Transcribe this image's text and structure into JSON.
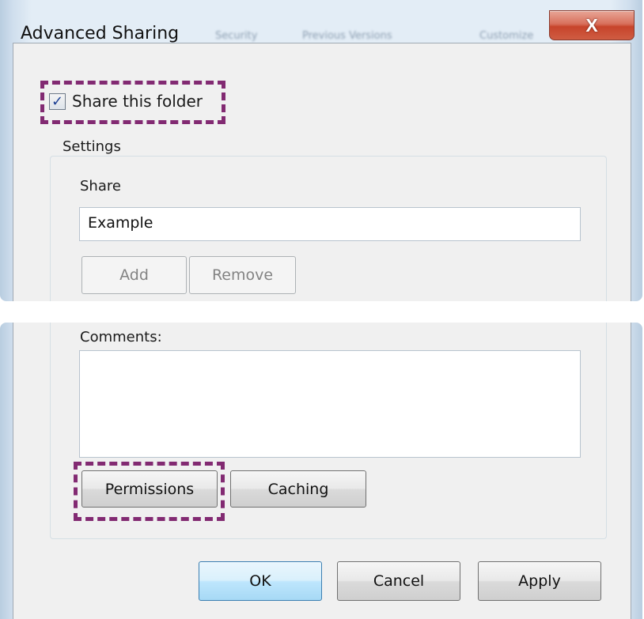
{
  "window": {
    "title": "Advanced Sharing",
    "background_tabs": [
      "Security",
      "Previous Versions",
      "Customize"
    ],
    "close_label": "X"
  },
  "share_checkbox": {
    "label": "Share this folder",
    "checked": true,
    "check_mark": "✓"
  },
  "settings": {
    "legend": "Settings",
    "share_label": "Share",
    "share_value": "Example",
    "add_label": "Add",
    "remove_label": "Remove",
    "comments_label": "Comments:",
    "comments_value": "",
    "permissions_label": "Permissions",
    "caching_label": "Caching"
  },
  "footer": {
    "ok_label": "OK",
    "cancel_label": "Cancel",
    "apply_label": "Apply"
  },
  "colors": {
    "highlight": "#822a72",
    "close_button": "#c7442b",
    "frame": "#cfdeed",
    "client": "#f0f0f0"
  },
  "icons": {
    "checkbox": "check-icon",
    "close": "close-icon"
  }
}
